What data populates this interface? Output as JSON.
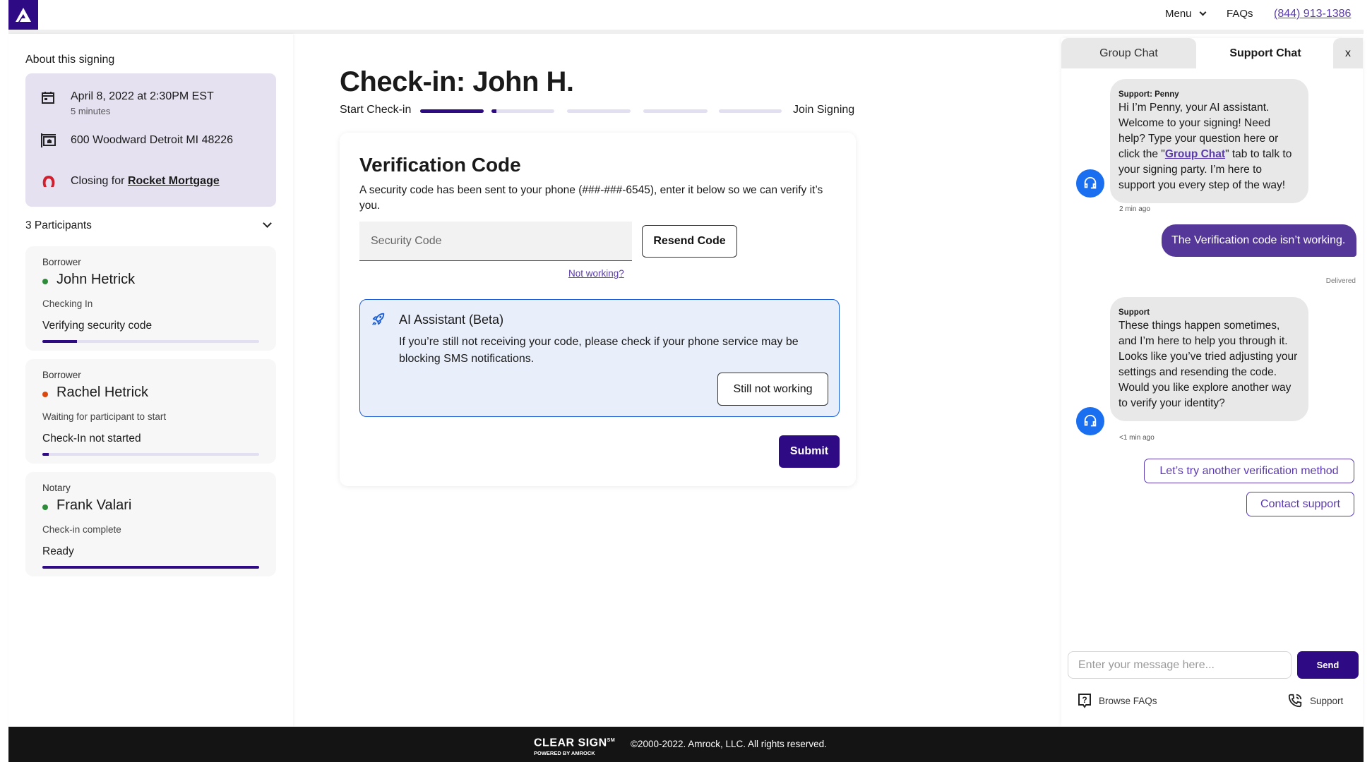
{
  "colors": {
    "brand": "#2e0a84",
    "accent": "#5a3aae",
    "info_blue": "#1a5fd6",
    "avatar_blue": "#1a6ff0",
    "status_green": "#2e8b3a",
    "status_orange": "#d9480f"
  },
  "header": {
    "menu": "Menu",
    "faqs": "FAQs",
    "phone": "(844) 913-1386"
  },
  "sidebar": {
    "about_title": "About this signing",
    "date": "April 8, 2022 at 2:30PM EST",
    "duration": "5 minutes",
    "address": "600 Woodward Detroit MI 48226",
    "closing_prefix": "Closing for",
    "closing_company": "Rocket Mortgage",
    "participants_title": "3 Participants",
    "participants": [
      {
        "role": "Borrower",
        "name": "John Hetrick",
        "status": "Checking In",
        "detail": "Verifying security code",
        "progress": 0.16,
        "dot": "green"
      },
      {
        "role": "Borrower",
        "name": "Rachel Hetrick",
        "status": "Waiting for participant to start",
        "detail": "Check-In not started",
        "progress": 0.03,
        "dot": "orange"
      },
      {
        "role": "Notary",
        "name": "Frank Valari",
        "status": "Check-in complete",
        "detail": "Ready",
        "progress": 1.0,
        "dot": "green"
      }
    ]
  },
  "main": {
    "title": "Check-in: John H.",
    "stepper": {
      "start_label": "Start Check-in",
      "end_label": "Join Signing",
      "steps": [
        1.0,
        0.08,
        0,
        0,
        0
      ]
    },
    "card": {
      "title": "Verification Code",
      "description": "A security code has been sent to your phone (###-###-6545), enter it below so we can verify it’s you.",
      "input_placeholder": "Security Code",
      "input_value": "",
      "resend": "Resend Code",
      "not_working": "Not working?",
      "ai": {
        "title": "AI Assistant (Beta)",
        "text": "If you’re still not receiving your code, please check if your phone service may be blocking SMS notifications.",
        "button": "Still not working"
      },
      "submit": "Submit"
    }
  },
  "chat": {
    "tabs": [
      {
        "label": "Group Chat",
        "active": false
      },
      {
        "label": "Support Chat",
        "active": true
      }
    ],
    "close": "x",
    "messages": [
      {
        "sender": "Support: Penny",
        "text_before": "Hi I’m Penny, your AI assistant. Welcome to your signing! Need help? Type your question here or click the \"",
        "link": "Group Chat",
        "text_after": "\" tab to talk to your signing party. I’m here to support you every step of the way!",
        "time": "2 min ago"
      },
      {
        "text": "The Verification code isn’t working.",
        "status": "Delivered"
      },
      {
        "sender": "Support",
        "text": "These things happen sometimes, and I’m here to help you through it. Looks like you’ve tried adjusting your settings and resending the code. Would you like explore another way to verify your identity?",
        "time": "<1 min ago"
      }
    ],
    "quick_replies": [
      "Let’s try another verification method",
      "Contact support"
    ],
    "input_placeholder": "Enter your message here...",
    "send": "Send",
    "browse_faqs": "Browse FAQs",
    "support": "Support"
  },
  "footer": {
    "logo_main": "CLEAR SIGN",
    "logo_sm": "SM",
    "logo_sub": "POWERED BY AMROCK",
    "copyright": "©2000-2022. Amrock, LLC. All rights reserved."
  }
}
